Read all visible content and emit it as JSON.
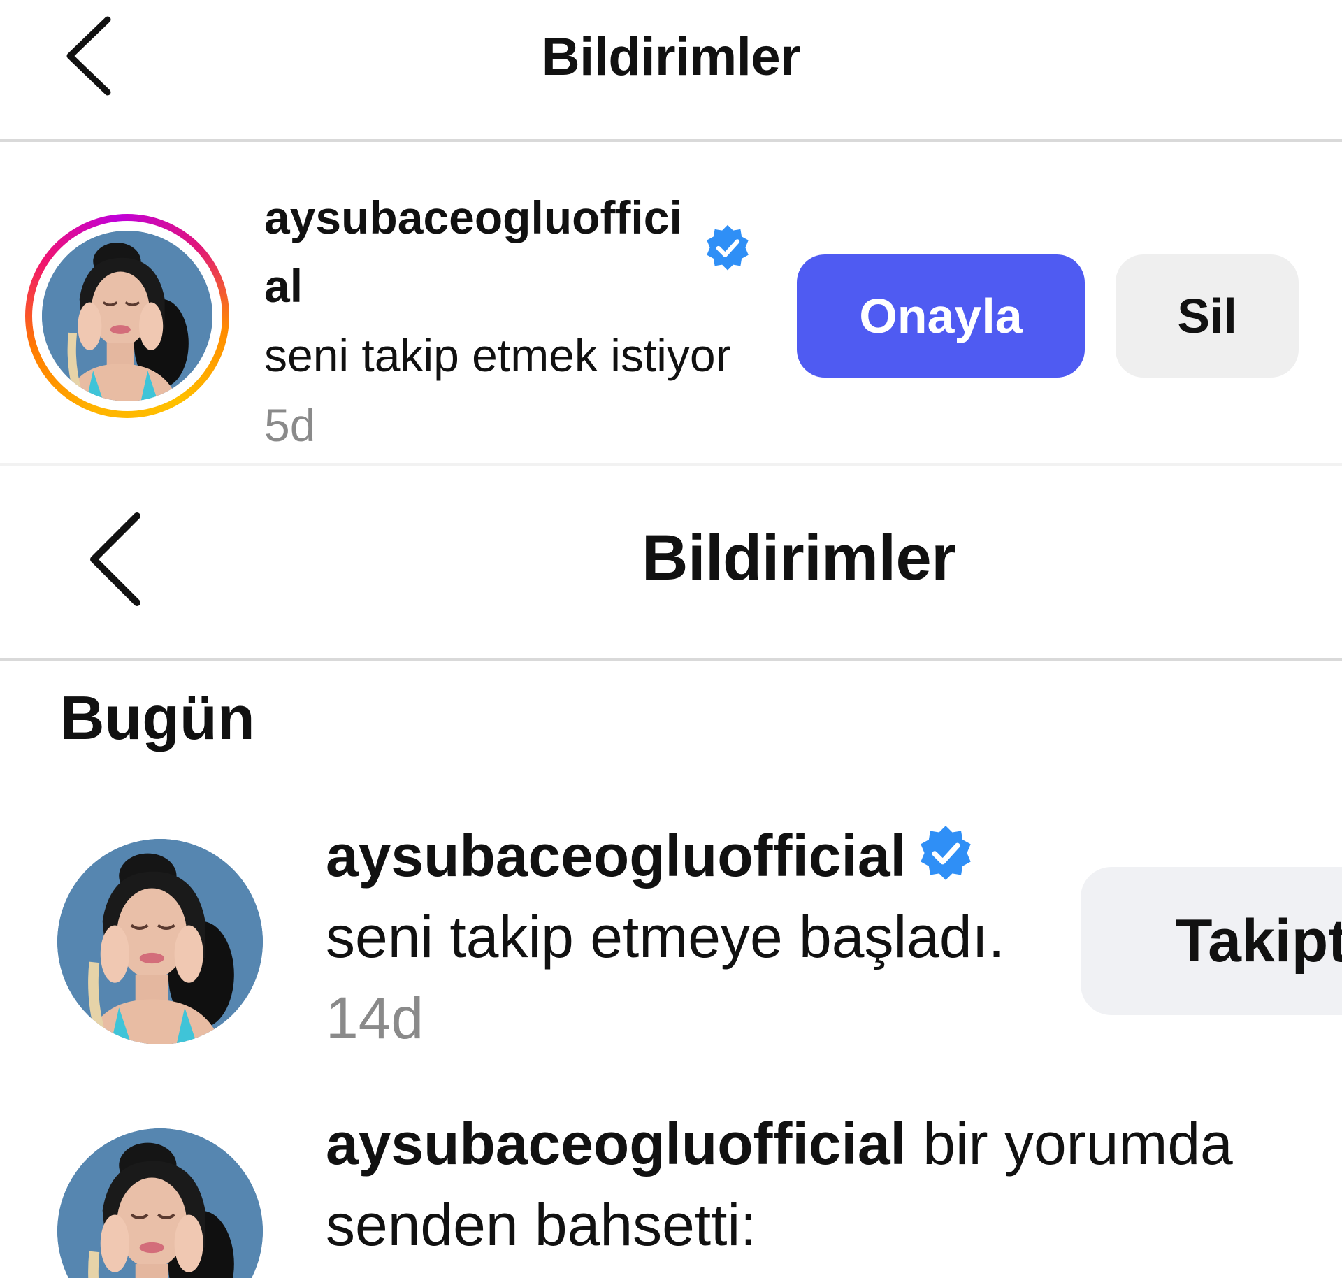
{
  "top_panel": {
    "header": {
      "title": "Bildirimler"
    },
    "request": {
      "username": "aysubaceogluofficial",
      "message": "seni takip etmek istiyor",
      "time": "5d",
      "approve_label": "Onayla",
      "delete_label": "Sil"
    }
  },
  "bottom_panel": {
    "header": {
      "title": "Bildirimler"
    },
    "section_title": "Bugün",
    "notifications": [
      {
        "username": "aysubaceogluofficial",
        "message": "seni takip etmeye başladı.",
        "time": "14d",
        "follow_label": "Takipt"
      },
      {
        "username": "aysubaceogluofficial",
        "message": "bir yorumda senden bahsetti:"
      }
    ]
  },
  "colors": {
    "approve_button": "#4f5bf2",
    "secondary_button": "#efefef",
    "verified_badge": "#2f8ff6",
    "timestamp": "#8a8a8a"
  },
  "icons": [
    "back-arrow-icon",
    "verified-badge-icon"
  ]
}
